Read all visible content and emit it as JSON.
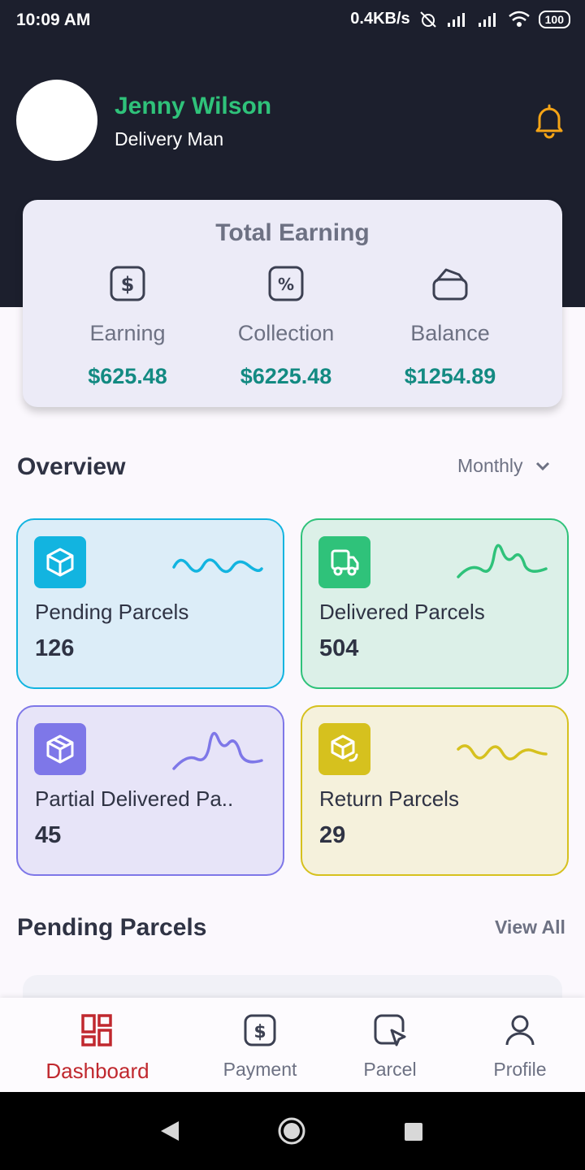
{
  "status_bar": {
    "time": "10:09 AM",
    "net_speed": "0.4KB/s",
    "battery": "100"
  },
  "user": {
    "name": "Jenny Wilson",
    "role": "Delivery Man"
  },
  "total_earning": {
    "title": "Total Earning",
    "items": [
      {
        "label": "Earning",
        "value": "$625.48",
        "icon": "dollar-icon"
      },
      {
        "label": "Collection",
        "value": "$6225.48",
        "icon": "percent-icon"
      },
      {
        "label": "Balance",
        "value": "$1254.89",
        "icon": "wallet-icon"
      }
    ]
  },
  "overview": {
    "title": "Overview",
    "period": "Monthly",
    "cards": [
      {
        "label": "Pending Parcels",
        "value": "126",
        "icon": "box-icon",
        "accent": "#12b4e0",
        "bg": "#dcedf8"
      },
      {
        "label": "Delivered Parcels",
        "value": "504",
        "icon": "truck-icon",
        "accent": "#2fc27a",
        "bg": "#dcf0e8"
      },
      {
        "label": "Partial Delivered Pa..",
        "value": "45",
        "icon": "box-icon",
        "accent": "#7e77e8",
        "bg": "#e7e4f8"
      },
      {
        "label": "Return Parcels",
        "value": "29",
        "icon": "return-box-icon",
        "accent": "#d6c11e",
        "bg": "#f5f1dc"
      }
    ]
  },
  "pending_section": {
    "title": "Pending Parcels",
    "view_all": "View All"
  },
  "bottom_nav": [
    {
      "label": "Dashboard",
      "icon": "dashboard-icon",
      "active": true
    },
    {
      "label": "Payment",
      "icon": "dollar-icon",
      "active": false
    },
    {
      "label": "Parcel",
      "icon": "parcel-icon",
      "active": false
    },
    {
      "label": "Profile",
      "icon": "person-icon",
      "active": false
    }
  ],
  "colors": {
    "header_bg": "#1c1f2d",
    "name_green": "#2fc27a",
    "earning_value": "#138a82",
    "bell": "#f5a416",
    "active_nav": "#c0282e"
  }
}
